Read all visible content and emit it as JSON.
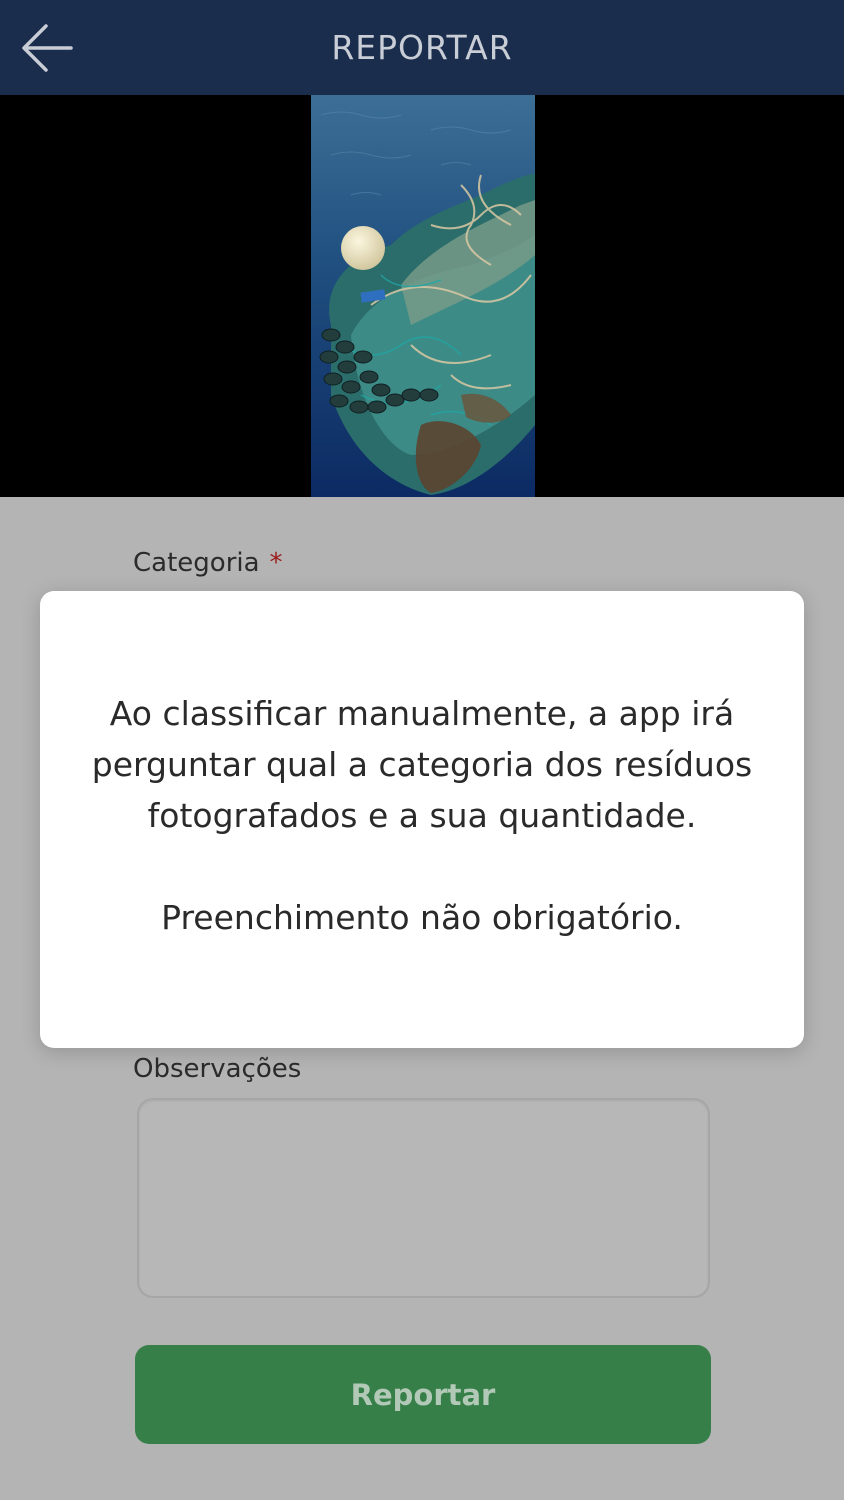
{
  "header": {
    "title": "REPORTAR",
    "back_icon": "arrow-left-icon"
  },
  "photo": {
    "description_icon": "marine-debris-photo"
  },
  "form": {
    "category_label": "Categoria",
    "required_marker": "*",
    "observations_label": "Observações",
    "observations_value": "",
    "submit_label": "Reportar"
  },
  "modal": {
    "message": "Ao classificar manualmente, a app irá perguntar qual a categoria dos resíduos fotografados e a sua quantidade.",
    "note": "Preenchimento não obrigatório."
  },
  "colors": {
    "header_bg": "#1a2d4c",
    "overlay_bg": "#b4b4b4",
    "button_bg": "#367f48",
    "required_star": "#9a1b1b"
  }
}
